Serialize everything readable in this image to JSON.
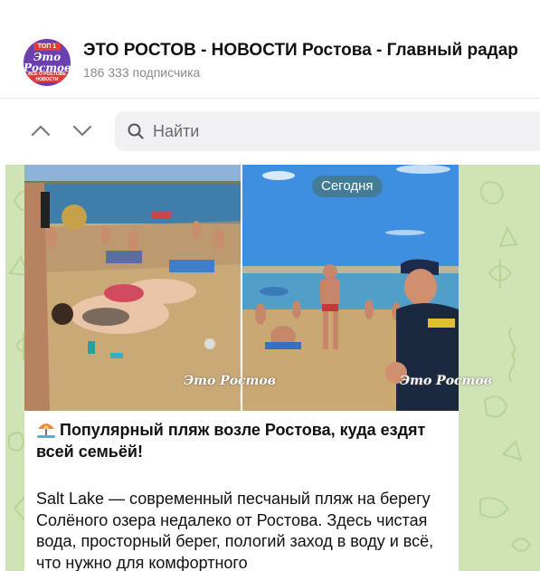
{
  "channel": {
    "title": "ЭТО РОСТОВ - НОВОСТИ Ростова - Главный радар",
    "subscribers": "186 333 подписчика",
    "avatar": {
      "badge": "ТОП 1",
      "logo": "Это Ростов",
      "sub": "ВСЕ О РОСТОВЕ НОВОСТИ"
    }
  },
  "navigation": {
    "up_icon": "chevron-up-icon",
    "down_icon": "chevron-down-icon"
  },
  "search": {
    "placeholder": "Найти",
    "value": ""
  },
  "message": {
    "date_label": "Сегодня",
    "photos": [
      {
        "watermark": "Это Ростов"
      },
      {
        "watermark": "Это Ростов"
      }
    ],
    "heading_emoji": "beach-umbrella-icon",
    "heading": "Популярный пляж возле Ростова, куда ездят всей семьёй!",
    "body": "Salt Lake — современный песчаный пляж на берегу Солёного озера недалеко от Ростова. Здесь чистая вода, просторный берег, пологий заход в воду и всё, что нужно для комфортного"
  },
  "colors": {
    "chat_background": "#cfe3b4",
    "accent": "#6b3fb0",
    "date_pill": "#5f8f73"
  }
}
